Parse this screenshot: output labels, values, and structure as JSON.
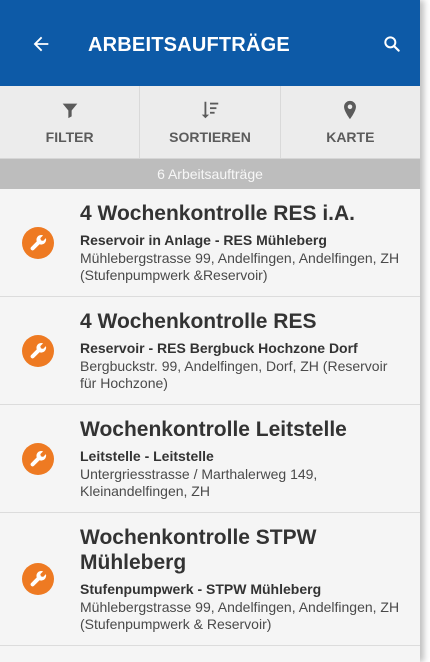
{
  "app_bar": {
    "title": "ARBEITSAUFTRÄGE",
    "back_icon": "arrow-left-icon",
    "search_icon": "search-icon",
    "color": "#0d5aa7"
  },
  "toolbar": {
    "items": [
      {
        "label": "FILTER",
        "icon": "filter-icon"
      },
      {
        "label": "SORTIEREN",
        "icon": "sort-icon"
      },
      {
        "label": "KARTE",
        "icon": "map-pin-icon"
      }
    ]
  },
  "count_label": "6 Arbeitsaufträge",
  "orders": [
    {
      "title": "4 Wochenkontrolle RES i.A.",
      "subtitle": "Reservoir in Anlage - RES Mühleberg",
      "address": "Mühlebergstrasse 99, Andelfingen, Andelfingen, ZH (Stufenpumpwerk &Reservoir)",
      "icon": "wrench-icon"
    },
    {
      "title": "4 Wochenkontrolle RES",
      "subtitle": "Reservoir - RES Bergbuck Hochzone Dorf",
      "address": "Bergbuckstr. 99, Andelfingen, Dorf, ZH (Reservoir für Hochzone)",
      "icon": "wrench-icon"
    },
    {
      "title": "Wochenkontrolle Leitstelle",
      "subtitle": "Leitstelle - Leitstelle",
      "address": "Untergriesstrasse / Marthalerweg 149, Kleinandelfingen, ZH",
      "icon": "wrench-icon"
    },
    {
      "title": "Wochenkontrolle STPW Mühleberg",
      "subtitle": "Stufenpumpwerk - STPW Mühleberg",
      "address": "Mühlebergstrasse 99, Andelfingen, Andelfingen, ZH (Stufenpumpwerk & Reservoir)",
      "icon": "wrench-icon"
    }
  ],
  "accent_color": "#ee7a22"
}
